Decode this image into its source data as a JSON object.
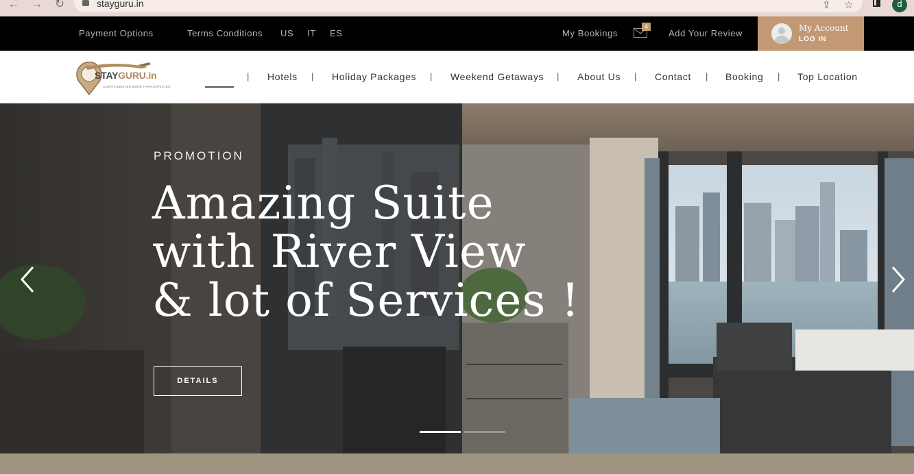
{
  "browser": {
    "url": "stayguru.in",
    "profile_initial": "d",
    "back_glyph": "←",
    "forward_glyph": "→",
    "reload_glyph": "↻",
    "share_glyph": "⇪",
    "star_glyph": "☆"
  },
  "topbar": {
    "links_left": [
      "Payment Options",
      "Terms Conditions",
      "US",
      "IT",
      "ES"
    ],
    "my_bookings": "My Bookings",
    "mail_count": "4",
    "add_review": "Add Your Review",
    "account_title": "My Account",
    "account_sub": "LOG IN"
  },
  "logo": {
    "text_main": "STAY",
    "text_accent": "GURU.in",
    "tagline": "ALWAYS DELIVER MORE THAN EXPECTED"
  },
  "nav": {
    "items": [
      "Hotels",
      "Holiday Packages",
      "Weekend Getaways",
      "About Us",
      "Contact",
      "Booking",
      "Top Location"
    ],
    "separator": "|"
  },
  "hero": {
    "eyebrow": "PROMOTION",
    "headline_lines": [
      "Amazing Suite",
      "with River View",
      "& lot of Services !"
    ],
    "button": "DETAILS",
    "slides": 2,
    "active_slide": 1
  },
  "colors": {
    "accent": "#c39874",
    "topbar_bg": "#000000",
    "footer_strip": "#9e9480"
  }
}
